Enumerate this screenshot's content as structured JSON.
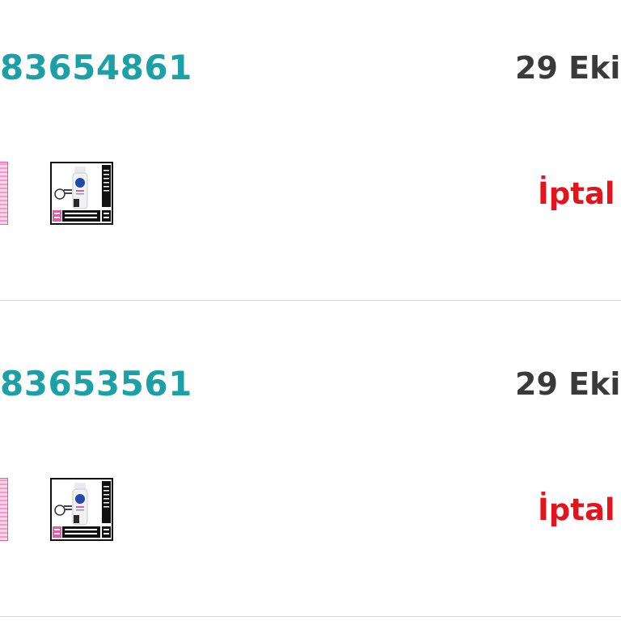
{
  "orders": [
    {
      "id": "83654861",
      "date": "29 Eki",
      "status": "İptal",
      "thumbnails": [
        "product-thumbnail-partial",
        "product-thumbnail-deodorant"
      ]
    },
    {
      "id": "83653561",
      "date": "29 Eki",
      "status": "İptal",
      "thumbnails": [
        "product-thumbnail-partial",
        "product-thumbnail-deodorant"
      ]
    }
  ],
  "colors": {
    "order_id": "#1ca0a6",
    "date": "#3a3a3a",
    "status_cancelled": "#e3141c",
    "divider": "#d4d4d4"
  }
}
